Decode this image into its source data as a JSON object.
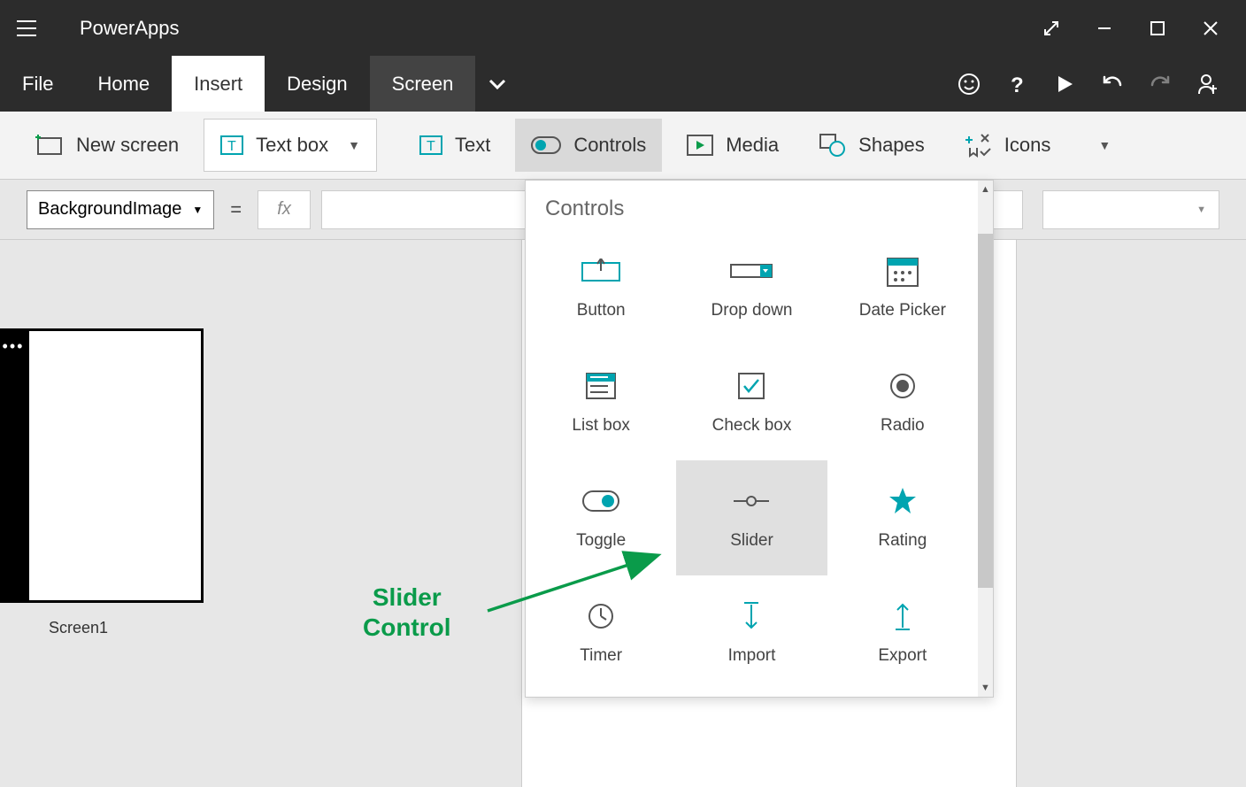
{
  "app": {
    "title": "PowerApps"
  },
  "menus": {
    "file": "File",
    "home": "Home",
    "insert": "Insert",
    "design": "Design",
    "screen": "Screen"
  },
  "ribbon": {
    "new_screen": "New screen",
    "text_box": "Text box",
    "text": "Text",
    "controls": "Controls",
    "media": "Media",
    "shapes": "Shapes",
    "icons": "Icons"
  },
  "formula": {
    "property": "BackgroundImage",
    "fx": "fx"
  },
  "screens": {
    "screen1": "Screen1"
  },
  "controls_popup": {
    "title": "Controls",
    "items": {
      "button": "Button",
      "dropdown": "Drop down",
      "datepicker": "Date Picker",
      "listbox": "List box",
      "checkbox": "Check box",
      "radio": "Radio",
      "toggle": "Toggle",
      "slider": "Slider",
      "rating": "Rating",
      "timer": "Timer",
      "import": "Import",
      "export": "Export"
    }
  },
  "annotation": {
    "line1": "Slider",
    "line2": "Control"
  }
}
